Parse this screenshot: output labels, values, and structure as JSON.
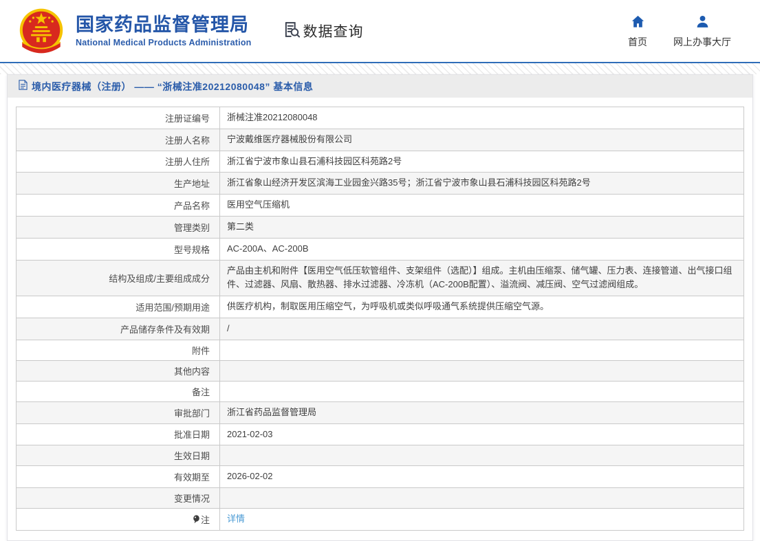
{
  "header": {
    "org_name_cn": "国家药品监督管理局",
    "org_name_en": "National Medical Products Administration",
    "section_label": "数据查询",
    "nav": [
      {
        "label": "首页",
        "icon": "home-icon"
      },
      {
        "label": "网上办事大厅",
        "icon": "person-icon"
      }
    ]
  },
  "panel": {
    "title": "境内医疗器械（注册） —— “浙械注准20212080048” 基本信息"
  },
  "table": {
    "rows": [
      {
        "label": "注册证编号",
        "value": "浙械注准20212080048"
      },
      {
        "label": "注册人名称",
        "value": "宁波戴维医疗器械股份有限公司"
      },
      {
        "label": "注册人住所",
        "value": "浙江省宁波市象山县石浦科技园区科苑路2号"
      },
      {
        "label": "生产地址",
        "value": "浙江省象山经济开发区滨海工业园金兴路35号；浙江省宁波市象山县石浦科技园区科苑路2号"
      },
      {
        "label": "产品名称",
        "value": "医用空气压缩机"
      },
      {
        "label": "管理类别",
        "value": "第二类"
      },
      {
        "label": "型号规格",
        "value": "AC-200A、AC-200B"
      },
      {
        "label": "结构及组成/主要组成成分",
        "value": "产品由主机和附件【医用空气低压软管组件、支架组件（选配）】组成。主机由压缩泵、储气罐、压力表、连接管道、出气接口组件、过滤器、风扇、散热器、排水过滤器、冷冻机（AC-200B配置）、溢流阀、减压阀、空气过滤阀组成。"
      },
      {
        "label": "适用范围/预期用途",
        "value": "供医疗机构，制取医用压缩空气，为呼吸机或类似呼吸通气系统提供压缩空气源。"
      },
      {
        "label": "产品储存条件及有效期",
        "value": "/"
      },
      {
        "label": "附件",
        "value": ""
      },
      {
        "label": "其他内容",
        "value": ""
      },
      {
        "label": "备注",
        "value": ""
      },
      {
        "label": "审批部门",
        "value": "浙江省药品监督管理局"
      },
      {
        "label": "批准日期",
        "value": "2021-02-03"
      },
      {
        "label": "生效日期",
        "value": ""
      },
      {
        "label": "有效期至",
        "value": "2026-02-02"
      },
      {
        "label": "变更情况",
        "value": ""
      },
      {
        "label": "注",
        "value": "详情",
        "label_icon": "note-icon",
        "value_is_link": true
      }
    ]
  },
  "colors": {
    "brand_blue": "#2456a8",
    "divider_blue": "#2f6db8",
    "link_blue": "#4a9ad4",
    "row_alt_bg": "#f5f5f5",
    "title_bar_bg": "#ececec",
    "emblem_red": "#d8291e",
    "emblem_gold": "#f6c300"
  }
}
